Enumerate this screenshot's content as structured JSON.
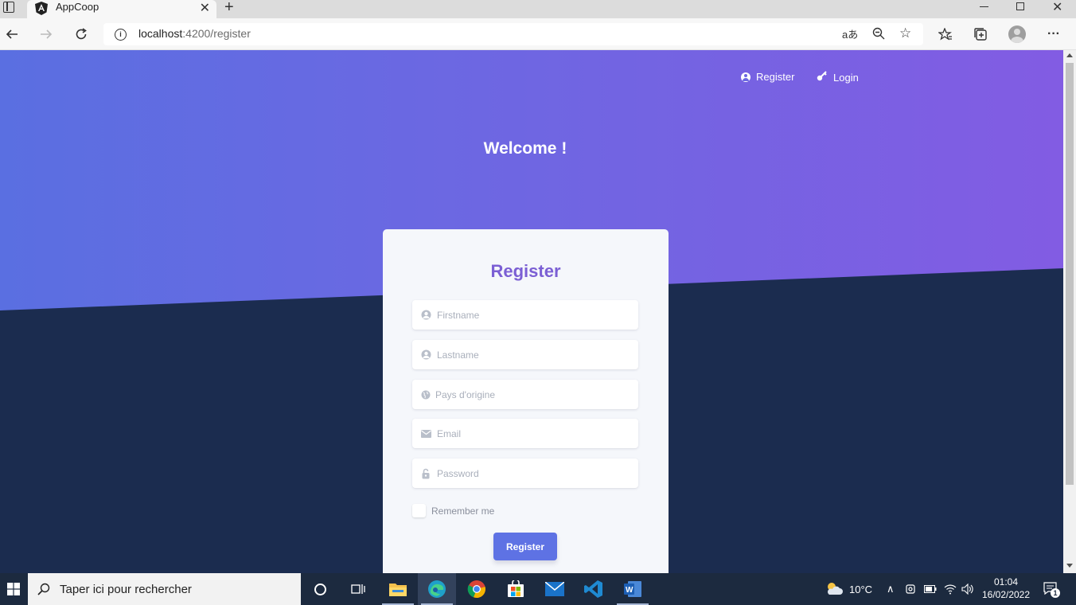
{
  "browser": {
    "tab_title": "AppCoop",
    "url_host": "localhost",
    "url_path": ":4200/register"
  },
  "nav": {
    "register_label": "Register",
    "login_label": "Login"
  },
  "hero": {
    "welcome": "Welcome !"
  },
  "form": {
    "title": "Register",
    "firstname_placeholder": "Firstname",
    "lastname_placeholder": "Lastname",
    "country_placeholder": "Pays d'origine",
    "email_placeholder": "Email",
    "password_placeholder": "Password",
    "remember_label": "Remember me",
    "submit_label": "Register"
  },
  "taskbar": {
    "search_placeholder": "Taper ici pour rechercher",
    "temperature": "10°C",
    "time": "01:04",
    "date": "16/02/2022",
    "notification_count": "1"
  },
  "colors": {
    "hero_start": "#5a6fe1",
    "hero_end": "#825ce3",
    "dark_bg": "#1b2c4f",
    "accent": "#5e72e4",
    "title": "#7b5fd4"
  }
}
